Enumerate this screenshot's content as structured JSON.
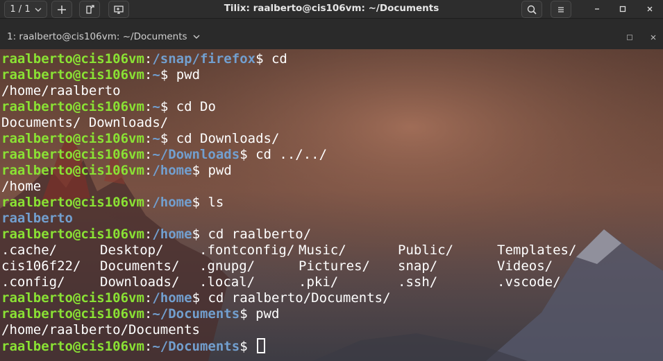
{
  "header": {
    "session_counter": "1 / 1",
    "window_title": "Tilix: raalberto@cis106vm: ~/Documents",
    "icons": [
      "chevron-down-icon",
      "plus-icon",
      "detach-icon",
      "add-terminal-icon",
      "search-icon",
      "hamburger-menu-icon",
      "minimize-icon",
      "maximize-icon",
      "close-icon"
    ]
  },
  "terminal_tab": {
    "title": "1: raalberto@cis106vm: ~/Documents"
  },
  "terminal": {
    "lines": [
      {
        "user": "raalberto@cis106vm",
        "sep": ":",
        "path": "/snap/firefox",
        "prompt": "$ ",
        "cmd": "cd"
      },
      {
        "user": "raalberto@cis106vm",
        "sep": ":",
        "path": "~",
        "prompt": "$ ",
        "cmd": "pwd"
      },
      {
        "output": "/home/raalberto"
      },
      {
        "user": "raalberto@cis106vm",
        "sep": ":",
        "path": "~",
        "prompt": "$ ",
        "cmd": "cd Do"
      },
      {
        "output": "Documents/ Downloads/"
      },
      {
        "user": "raalberto@cis106vm",
        "sep": ":",
        "path": "~",
        "prompt": "$ ",
        "cmd": "cd Downloads/"
      },
      {
        "user": "raalberto@cis106vm",
        "sep": ":",
        "path": "~/Downloads",
        "prompt": "$ ",
        "cmd": "cd ../../"
      },
      {
        "user": "raalberto@cis106vm",
        "sep": ":",
        "path": "/home",
        "prompt": "$ ",
        "cmd": "pwd"
      },
      {
        "output": "/home"
      },
      {
        "user": "raalberto@cis106vm",
        "sep": ":",
        "path": "/home",
        "prompt": "$ ",
        "cmd": "ls"
      },
      {
        "dir_output": "raalberto"
      },
      {
        "user": "raalberto@cis106vm",
        "sep": ":",
        "path": "/home",
        "prompt": "$ ",
        "cmd": "cd raalberto/"
      }
    ],
    "ls_grid": [
      [
        ".cache/",
        "Desktop/",
        ".fontconfig/",
        "Music/",
        "Public/",
        "Templates/"
      ],
      [
        "cis106f22/",
        "Documents/",
        ".gnupg/",
        "Pictures/",
        "snap/",
        "Videos/"
      ],
      [
        ".config/",
        "Downloads/",
        ".local/",
        ".pki/",
        ".ssh/",
        ".vscode/"
      ]
    ],
    "after_lines": [
      {
        "user": "raalberto@cis106vm",
        "sep": ":",
        "path": "/home",
        "prompt": "$ ",
        "cmd": "cd raalberto/Documents/"
      },
      {
        "user": "raalberto@cis106vm",
        "sep": ":",
        "path": "~/Documents",
        "prompt": "$ ",
        "cmd": "pwd"
      },
      {
        "output": "/home/raalberto/Documents"
      }
    ],
    "current_prompt": {
      "user": "raalberto@cis106vm",
      "sep": ":",
      "path": "~/Documents",
      "prompt": "$ "
    },
    "colors": {
      "user": "#8ae234",
      "path": "#729fcf",
      "text": "#ffffff"
    }
  }
}
